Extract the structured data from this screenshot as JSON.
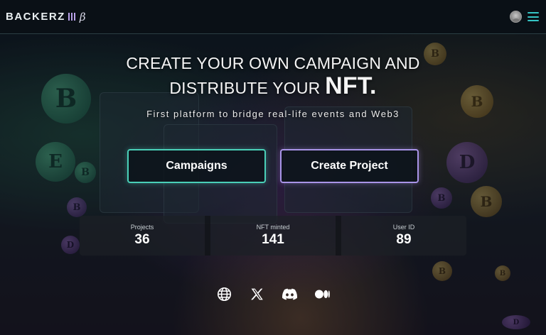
{
  "header": {
    "logo_text": "BACKERZ",
    "logo_beta": "β",
    "avatar_icon": "user-avatar-icon",
    "menu_icon": "hamburger-menu-icon"
  },
  "hero": {
    "headline_line1": "CREATE YOUR OWN CAMPAIGN AND",
    "headline_line2_prefix": "DISTRIBUTE YOUR",
    "headline_line2_emphasis": "NFT.",
    "subtitle": "First platform to bridge real-life events and Web3"
  },
  "buttons": {
    "campaigns": "Campaigns",
    "create_project": "Create Project"
  },
  "stats": [
    {
      "label": "Projects",
      "value": "36"
    },
    {
      "label": "NFT minted",
      "value": "141"
    },
    {
      "label": "User ID",
      "value": "89"
    }
  ],
  "socials": [
    {
      "icon": "globe-icon"
    },
    {
      "icon": "x-twitter-icon"
    },
    {
      "icon": "discord-icon"
    },
    {
      "icon": "medium-icon"
    }
  ],
  "colors": {
    "campaigns_border": "#4ad0b8",
    "create_border": "#a994e8",
    "menu_accent": "#35c4c4",
    "logo_accent": "#b9a2ea"
  }
}
